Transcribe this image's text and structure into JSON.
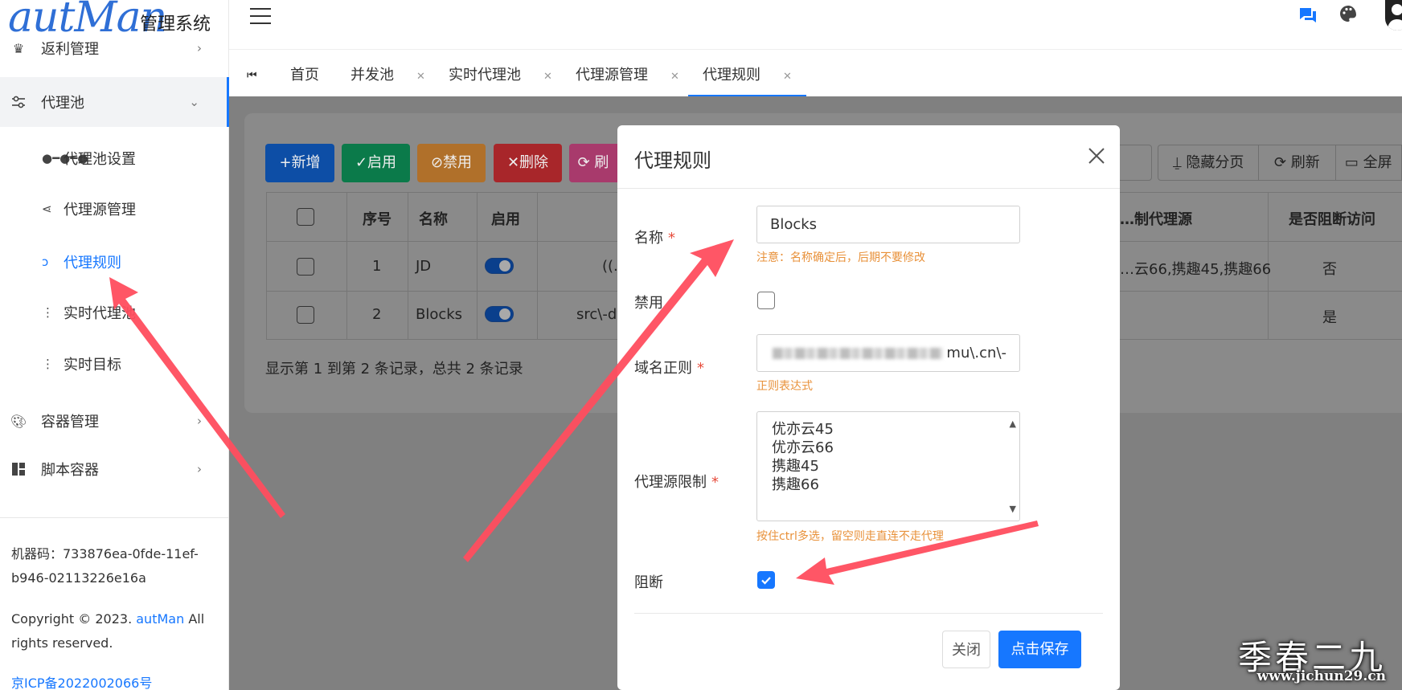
{
  "brand": {
    "logo_text": "autMan",
    "subtitle": "管理系统"
  },
  "sidebar": {
    "items": [
      {
        "label": "返利管理",
        "icon": "crown-icon"
      },
      {
        "label": "代理池",
        "icon": "sliders-icon"
      },
      {
        "label": "容器管理",
        "icon": "palette-icon"
      },
      {
        "label": "脚本容器",
        "icon": "grid-icon"
      }
    ],
    "subitems": [
      {
        "label": "代理池设置",
        "icon": "nodes-icon"
      },
      {
        "label": "代理源管理",
        "icon": "share-icon"
      },
      {
        "label": "代理规则",
        "icon": "branch-icon"
      },
      {
        "label": "实时代理池",
        "icon": "dots-vertical-icon"
      },
      {
        "label": "实时目标",
        "icon": "dots-vertical-icon"
      }
    ],
    "footer": {
      "machine_code": "机器码：733876ea-0fde-11ef-b946-02113226e16a",
      "copyright_pre": "Copyright © 2023.",
      "copyright_link": "autMan",
      "copyright_post": "All rights reserved.",
      "icp": "京ICP备2022002066号"
    }
  },
  "tabs": [
    {
      "label": "首页",
      "closable": false
    },
    {
      "label": "并发池",
      "closable": true
    },
    {
      "label": "实时代理池",
      "closable": true
    },
    {
      "label": "代理源管理",
      "closable": true
    },
    {
      "label": "代理规则",
      "closable": true,
      "active": true
    }
  ],
  "toolbar": {
    "add": "+新增",
    "enable": "✓启用",
    "disable": "⊘禁用",
    "delete": "✕删除",
    "refresh_partial": "⟳ 刷",
    "hide_paging": "隐藏分页",
    "refresh": "刷新",
    "fullscreen": "全屏"
  },
  "table": {
    "headers": {
      "index": "序号",
      "name": "名称",
      "enabled": "启用",
      "source": "…制代理源",
      "block": "是否阻断访问"
    },
    "rows": [
      {
        "index": "1",
        "name": "JD",
        "enabled": true,
        "regex_partial": "((.",
        "sources_partial": "…云66,携趣45,携趣66",
        "block": "否"
      },
      {
        "index": "2",
        "name": "Blocks",
        "enabled": true,
        "regex_partial": "src\\-dy",
        "sources_partial": "",
        "block": "是"
      }
    ],
    "summary": "显示第 1 到第 2 条记录，总共 2 条记录"
  },
  "modal": {
    "title": "代理规则",
    "name_label": "名称",
    "name_value": "Blocks",
    "name_hint": "注意：名称确定后，后期不要修改",
    "disable_label": "禁用",
    "disable_checked": false,
    "regex_label": "域名正则",
    "regex_value_visible": "mu\\.cn\\-",
    "regex_hint": "正则表达式",
    "source_label": "代理源限制",
    "source_options": [
      "优亦云45",
      "优亦云66",
      "携趣45",
      "携趣66"
    ],
    "source_hint": "按住ctrl多选，留空则走直连不走代理",
    "block_label": "阻断",
    "block_checked": true,
    "close_btn": "关闭",
    "save_btn": "点击保存"
  },
  "watermark": {
    "cn": "季春二九",
    "url": "www.jichun29.cn"
  },
  "colors": {
    "primary": "#1677ff",
    "add": "#0d4ea6",
    "enable": "#0b7a4a",
    "disable": "#b0702a",
    "delete": "#a8262a",
    "pink": "#a83a6c",
    "arrow": "#ff4d5e",
    "hint": "#e8913a",
    "required": "#e74c3c"
  }
}
